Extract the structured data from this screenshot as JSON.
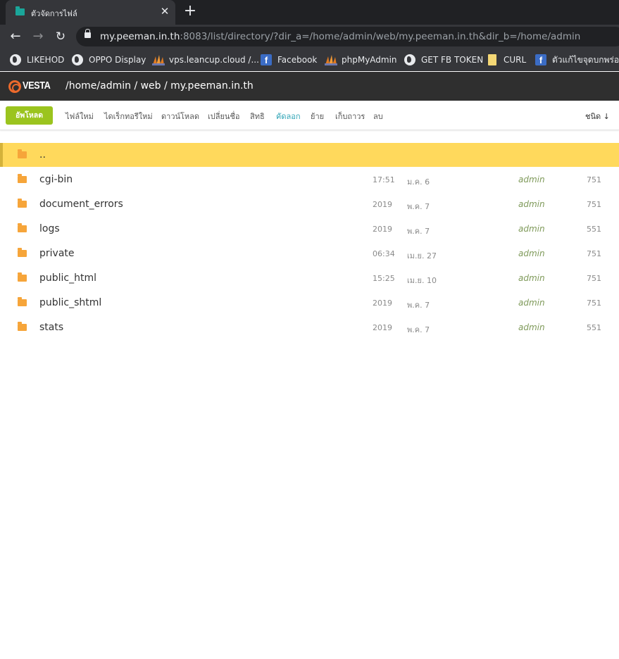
{
  "browser": {
    "tab_title": "ตัวจัดการไฟล์",
    "tab_close": "✕",
    "new_tab": "+",
    "url_host": "my.peeman.in.th",
    "url_rest": ":8083/list/directory/?dir_a=/home/admin/web/my.peeman.in.th&dir_b=/home/admin",
    "bookmarks": [
      {
        "label": "LIKEHOD",
        "icon": "globe-icon"
      },
      {
        "label": "OPPO Display",
        "icon": "globe-icon"
      },
      {
        "label": "vps.leancup.cloud /...",
        "icon": "phpmyadmin-icon"
      },
      {
        "label": "Facebook",
        "icon": "facebook-icon"
      },
      {
        "label": "phpMyAdmin",
        "icon": "phpmyadmin-icon"
      },
      {
        "label": "GET FB TOKEN",
        "icon": "globe-icon"
      },
      {
        "label": "CURL",
        "icon": "note-icon"
      },
      {
        "label": "ตัวแก้ไขจุดบกพร่องข",
        "icon": "facebook-icon"
      }
    ]
  },
  "header": {
    "logo_text": "VESTA",
    "breadcrumb": "/home/admin / web / my.peeman.in.th"
  },
  "actions": {
    "upload": "อัพโหลด",
    "items": [
      "ไฟล์ใหม่",
      "ไดเร็กทอรีใหม่",
      "ดาวน์โหลด",
      "เปลี่ยนชื่อ",
      "สิทธิ",
      "คัดลอก",
      "ย้าย",
      "เก็บถาวร",
      "ลบ"
    ],
    "active_item": "คัดลอก",
    "sort": "ชนิด ↓"
  },
  "files": [
    {
      "name": "..",
      "time": "",
      "date": "",
      "owner": "",
      "perm": "",
      "selected": true
    },
    {
      "name": "cgi-bin",
      "time": "17:51",
      "date": "ม.ค. 6",
      "owner": "admin",
      "perm": "751"
    },
    {
      "name": "document_errors",
      "time": "2019",
      "date": "พ.ค. 7",
      "owner": "admin",
      "perm": "751"
    },
    {
      "name": "logs",
      "time": "2019",
      "date": "พ.ค. 7",
      "owner": "admin",
      "perm": "551"
    },
    {
      "name": "private",
      "time": "06:34",
      "date": "เม.ย. 27",
      "owner": "admin",
      "perm": "751"
    },
    {
      "name": "public_html",
      "time": "15:25",
      "date": "เม.ย. 10",
      "owner": "admin",
      "perm": "751"
    },
    {
      "name": "public_shtml",
      "time": "2019",
      "date": "พ.ค. 7",
      "owner": "admin",
      "perm": "751"
    },
    {
      "name": "stats",
      "time": "2019",
      "date": "พ.ค. 7",
      "owner": "admin",
      "perm": "551"
    }
  ],
  "colors": {
    "selected_row": "#ffd95c",
    "folder": "#f6a53a",
    "upload_button": "#9bc41e",
    "active_action": "#2ca3b5",
    "owner_text": "#7f9a5a"
  }
}
